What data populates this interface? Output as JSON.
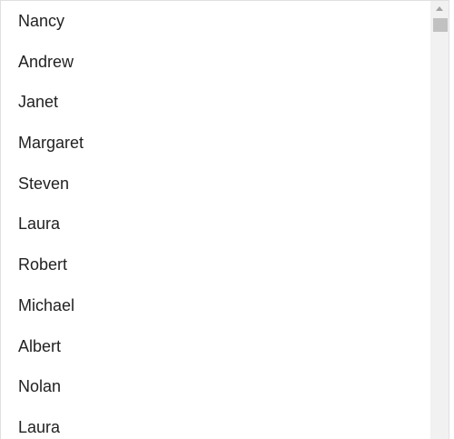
{
  "list": {
    "items": [
      {
        "label": "Nancy"
      },
      {
        "label": "Andrew"
      },
      {
        "label": "Janet"
      },
      {
        "label": "Margaret"
      },
      {
        "label": "Steven"
      },
      {
        "label": "Laura"
      },
      {
        "label": "Robert"
      },
      {
        "label": "Michael"
      },
      {
        "label": "Albert"
      },
      {
        "label": "Nolan"
      },
      {
        "label": "Laura"
      }
    ]
  },
  "scrollbar": {
    "icon_up": "scroll-up-arrow-icon",
    "scroll_position": 0.0
  },
  "colors": {
    "text": "#222222",
    "border": "#e0e0e0",
    "scrollbar_track": "#f1f1f1",
    "scrollbar_thumb": "#c1c1c1",
    "scrollbar_arrow": "#a3a3a3"
  }
}
